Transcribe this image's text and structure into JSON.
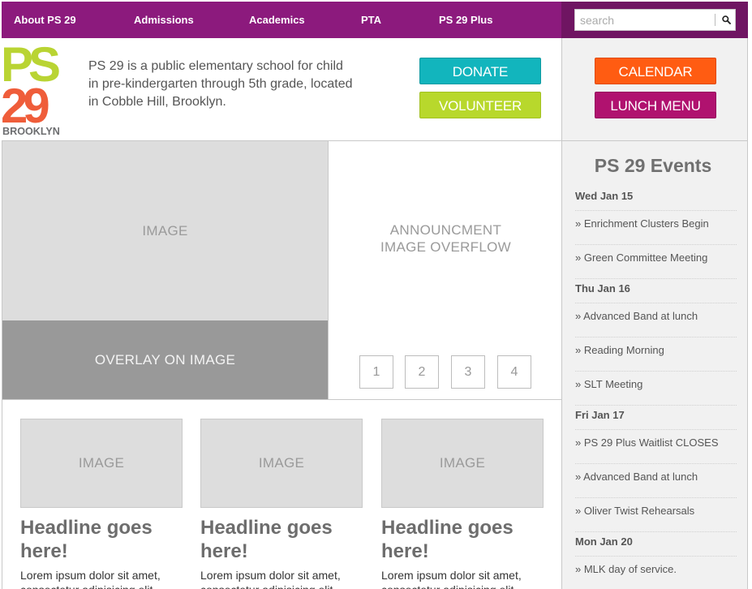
{
  "nav": {
    "items": [
      {
        "label": "About PS 29"
      },
      {
        "label": "Admissions"
      },
      {
        "label": "Academics"
      },
      {
        "label": "PTA"
      },
      {
        "label": "PS 29 Plus"
      }
    ],
    "search_placeholder": "search",
    "search_icon": "magnifier-icon"
  },
  "header": {
    "logo": {
      "line1": "PS",
      "line2": "29",
      "line3": "BROOKLYN"
    },
    "intro": "PS 29 is a public elementary school for child in pre-kindergarten through 5th grade, located in Cobble Hill, Brooklyn.",
    "donate_label": "DONATE",
    "volunteer_label": "VOLUNTEER",
    "calendar_label": "CALENDAR",
    "lunch_label": "LUNCH MENU"
  },
  "hero": {
    "image_label": "IMAGE",
    "overlay_label": "OVERLAY ON IMAGE",
    "announcement_line1": "ANNOUNCMENT",
    "announcement_line2": "IMAGE OVERFLOW",
    "pages": [
      "1",
      "2",
      "3",
      "4"
    ]
  },
  "cards": [
    {
      "image_label": "IMAGE",
      "headline": "Headline goes here!",
      "text": "Lorem ipsum dolor sit amet, consectetur adipisicing elit"
    },
    {
      "image_label": "IMAGE",
      "headline": "Headline goes here!",
      "text": "Lorem ipsum dolor sit amet, consectetur adipisicing elit"
    },
    {
      "image_label": "IMAGE",
      "headline": "Headline goes here!",
      "text": "Lorem ipsum dolor sit amet, consectetur adipisicing elit"
    }
  ],
  "events": {
    "title": "PS 29 Events",
    "days": [
      {
        "date": "Wed Jan 15",
        "items": [
          "» Enrichment Clusters Begin",
          "» Green Committee Meeting"
        ]
      },
      {
        "date": "Thu Jan 16",
        "items": [
          "» Advanced Band at lunch",
          "» Reading Morning",
          "» SLT Meeting"
        ]
      },
      {
        "date": "Fri Jan 17",
        "items": [
          "» PS 29 Plus Waitlist CLOSES",
          "» Advanced Band at lunch",
          "» Oliver Twist Rehearsals"
        ]
      },
      {
        "date": "Mon Jan 20",
        "items": [
          "» MLK day of service."
        ]
      }
    ]
  },
  "colors": {
    "nav_bg": "#8c1a7d",
    "search_zone_bg": "#6f1562",
    "donate": "#12b5bd",
    "volunteer": "#b8d82c",
    "calendar": "#ff5c12",
    "lunch_menu": "#b0126f",
    "logo_ps_lime": "#b9d433",
    "logo_ps_magenta": "#b0126f",
    "logo_29_orange": "#ef5d3a",
    "logo_29_teal": "#3bbdc4",
    "logo_brooklyn": "#6d6e70"
  }
}
